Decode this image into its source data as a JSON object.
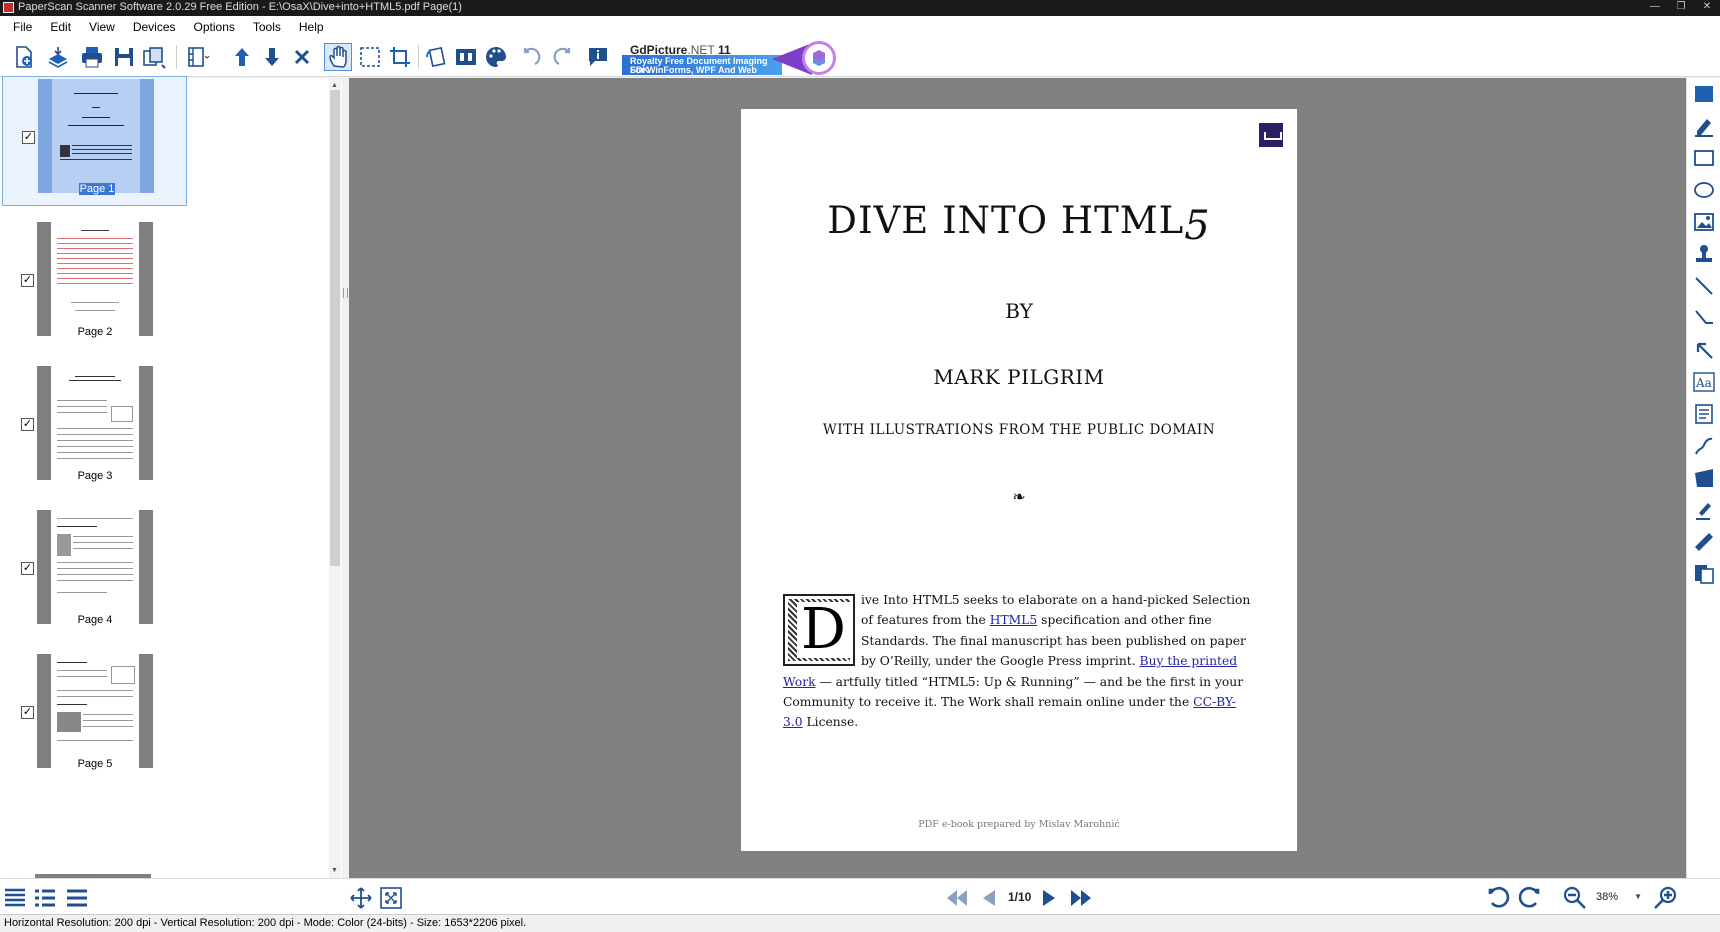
{
  "window": {
    "title": "PaperScan Scanner Software 2.0.29 Free Edition - E:\\OsaX\\Dive+into+HTML5.pdf Page(1)"
  },
  "menu": [
    "File",
    "Edit",
    "View",
    "Devices",
    "Options",
    "Tools",
    "Help"
  ],
  "ad": {
    "brand": "GdPicture",
    "brand_suffix": ".NET",
    "version": "11",
    "line1": "Royalty Free Document Imaging SDK",
    "line2": "For WinForms, WPF And Web"
  },
  "thumbnails": [
    {
      "label": "Page 1",
      "checked": true,
      "selected": true
    },
    {
      "label": "Page 2",
      "checked": true,
      "selected": false
    },
    {
      "label": "Page 3",
      "checked": true,
      "selected": false
    },
    {
      "label": "Page 4",
      "checked": true,
      "selected": false
    },
    {
      "label": "Page 5",
      "checked": true,
      "selected": false
    }
  ],
  "document": {
    "title_main": "DIVE INTO HTML",
    "title_5": "5",
    "by": "BY",
    "author": "MARK PILGRIM",
    "illustrations": "WITH ILLUSTRATIONS FROM THE PUBLIC DOMAIN",
    "fleuron": "❧",
    "dropcap": "D",
    "body_1": "ive Into HTML5 seeks to elaborate on a hand-picked Selection of features from the ",
    "link_html5": "HTML5",
    "body_2": " specification and other fine Standards. The final manuscript has been published on paper by O’Reilly, under the Google Press imprint. ",
    "link_buy": "Buy the printed Work",
    "body_3": " — artfully titled “HTML5: Up & Running” — and be the first in your Community to receive it. The Work shall remain online under the ",
    "link_cc": "CC-BY-3.0",
    "body_4": " License.",
    "footer": "PDF e-book prepared by Mislav Marohnić"
  },
  "navigation": {
    "page_indicator": "1/10",
    "zoom": "38%"
  },
  "status": "Horizontal Resolution:  200 dpi - Vertical Resolution:  200 dpi - Mode: Color (24-bits) - Size: 1653*2206 pixel.",
  "colors": {
    "accent": "#1f5fb4",
    "selection": "#3b78d6",
    "viewer_bg": "#808080"
  }
}
